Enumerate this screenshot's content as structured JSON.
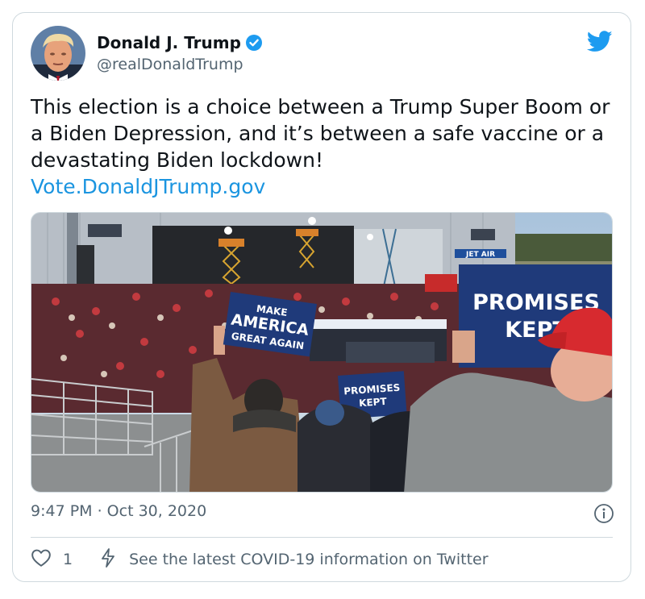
{
  "tweet": {
    "author_name": "Donald J. Trump",
    "author_handle": "@realDonaldTrump",
    "text": "This election is a choice between a Trump Super Boom or a Biden Depression, and it’s between a safe vaccine or a devastating Biden lockdown!",
    "link": "Vote.DonaldJTrump.gov",
    "timestamp": "9:47 PM · Oct 30, 2020",
    "like_count": "1",
    "covid_notice": "See the latest COVID-19 information on Twitter"
  },
  "media": {
    "sign_make_line1": "MAKE",
    "sign_make_line2": "AMERICA",
    "sign_make_line3": "GREAT AGAIN",
    "sign_promises_line1": "PROMISES",
    "sign_promises_line2": "KEPT",
    "sign_small_line1": "PROMISES",
    "sign_small_line2": "KEPT",
    "hangar_sign": "JET AIR"
  },
  "icons": {
    "verified": "verified-badge-icon",
    "bird": "twitter-bird-icon",
    "info": "info-icon",
    "like": "heart-icon",
    "covid": "lightning-bolt-icon"
  },
  "colors": {
    "link": "#1b95e0",
    "text": "#0f1419",
    "secondary": "#536471",
    "twitter_blue": "#1d9bf0"
  }
}
